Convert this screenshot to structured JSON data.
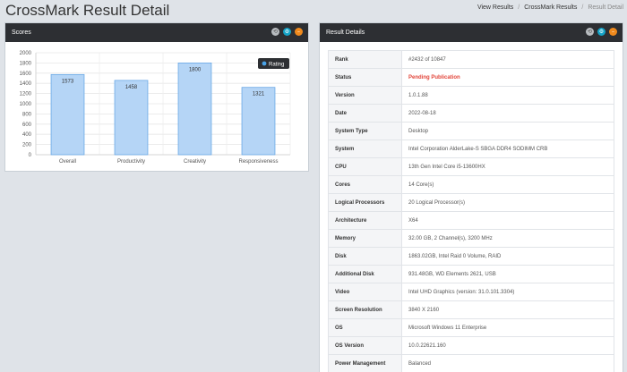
{
  "page": {
    "title": "CrossMark Result Detail"
  },
  "breadcrumb": [
    {
      "label": "View Results"
    },
    {
      "label": "CrossMark Results"
    },
    {
      "label": "Result Detail"
    }
  ],
  "panel_controls": {
    "refresh_glyph": "⟲",
    "settings_glyph": "⚙",
    "minimize_glyph": "–",
    "refresh_icon": "refresh-icon",
    "settings_icon": "gear-icon",
    "minimize_icon": "minus-icon"
  },
  "scores_panel": {
    "title": "Scores",
    "legend_label": "Rating"
  },
  "chart_data": {
    "type": "bar",
    "categories": [
      "Overall",
      "Productivity",
      "Creativity",
      "Responsiveness"
    ],
    "series": [
      {
        "name": "Rating",
        "values": [
          1573,
          1458,
          1800,
          1321
        ]
      }
    ],
    "yticks": [
      0,
      200,
      400,
      600,
      800,
      1000,
      1200,
      1400,
      1600,
      1800,
      2000
    ],
    "ylim": [
      0,
      2000
    ],
    "grid": true,
    "legend_position": "top-right",
    "bar_fill": "#b5d5f6",
    "bar_stroke": "#6aa8e6",
    "legend_dot_color": "#4aa3e8"
  },
  "details_panel": {
    "title": "Result Details",
    "rows": [
      {
        "key": "Rank",
        "value": "#2432 of 10847"
      },
      {
        "key": "Status",
        "value": "Pending Publication",
        "highlight": true
      },
      {
        "key": "Version",
        "value": "1.0.1.88"
      },
      {
        "key": "Date",
        "value": "2022-08-18"
      },
      {
        "key": "System Type",
        "value": "Desktop"
      },
      {
        "key": "System",
        "value": "Intel Corporation AlderLake-S SBGA DDR4 SODIMM CRB"
      },
      {
        "key": "CPU",
        "value": "13th Gen Intel Core i5-13600HX"
      },
      {
        "key": "Cores",
        "value": "14 Core(s)"
      },
      {
        "key": "Logical Processors",
        "value": "20 Logical Processor(s)"
      },
      {
        "key": "Architecture",
        "value": "X64"
      },
      {
        "key": "Memory",
        "value": "32.00 GB, 2 Channel(s), 3200 MHz"
      },
      {
        "key": "Disk",
        "value": "1863.02GB, Intel Raid 0 Volume, RAID"
      },
      {
        "key": "Additional Disk",
        "value": "931.48GB, WD Elements 2621, USB"
      },
      {
        "key": "Video",
        "value": "Intel UHD Graphics (version: 31.0.101.3304)"
      },
      {
        "key": "Screen Resolution",
        "value": "3840 X 2160"
      },
      {
        "key": "OS",
        "value": "Microsoft Windows 11 Enterprise"
      },
      {
        "key": "OS Version",
        "value": "10.0.22621.160"
      },
      {
        "key": "Power Management",
        "value": "Balanced"
      }
    ]
  }
}
